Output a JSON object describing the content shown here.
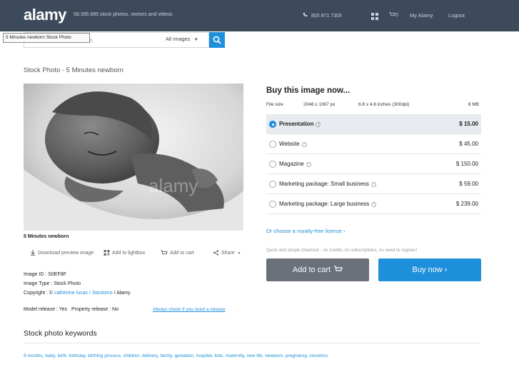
{
  "header": {
    "logo": "alamy",
    "tagline": "58,395,685 stock photos, vectors and videos",
    "phone": "800 871 7305",
    "cart": "0",
    "my_alamy": "My Alamy",
    "logout": "Logout"
  },
  "search": {
    "value": "orn",
    "tooltip": "5 Minutes newborn Stock Photo",
    "scope": "All images"
  },
  "page": {
    "title": "Stock Photo - 5 Minutes newborn",
    "caption": "5 Minutes newborn",
    "watermark": "alamy"
  },
  "actions": {
    "download": "Download preview image",
    "lightbox": "Add to lightbox",
    "cart": "Add to cart",
    "share": "Share"
  },
  "meta": {
    "image_id_label": "Image ID :",
    "image_id": "S0EF8F",
    "image_type_label": "Image Type :",
    "image_type": "Stock Photo",
    "copyright_label": "Copyright : ©",
    "copyright_author": "catherine lucas / Stockimo",
    "copyright_suffix": "/ Alamy",
    "model_release": "Model release : Yes",
    "property_release": "Property release : No",
    "release_link": "Always check if you need a release"
  },
  "keywords": {
    "title": "Stock photo keywords",
    "list": "9 months, baby, birth, birthday, birthing process, children, delivery, family, gestation, hospital, kids, maternity, new life, newborn, pregnancy, stockimo"
  },
  "buy": {
    "title": "Buy this image now...",
    "file_size_label": "File size",
    "pixels": "2048 x 1367 px",
    "inches": "6.8 x 4.6 inches (300dpi)",
    "mb": "8 MB",
    "options": [
      {
        "label": "Presentation",
        "price": "$ 15.00",
        "selected": true
      },
      {
        "label": "Website",
        "price": "$ 45.00",
        "selected": false
      },
      {
        "label": "Magazine",
        "price": "$ 150.00",
        "selected": false
      },
      {
        "label": "Marketing package: Small business",
        "price": "$ 59.00",
        "selected": false
      },
      {
        "label": "Marketing package: Large business",
        "price": "$ 239.00",
        "selected": false
      }
    ],
    "royalty_link": "Or choose a royalty-free license ›",
    "checkout_note": "Quick and simple checkout - no credits, no subscriptions, no need to register!",
    "add_to_cart": "Add to cart",
    "buy_now": "Buy now ›"
  },
  "colors": {
    "header_bg": "#3d4a5c",
    "accent": "#1e8fdb",
    "cart_button": "#6b717a"
  }
}
